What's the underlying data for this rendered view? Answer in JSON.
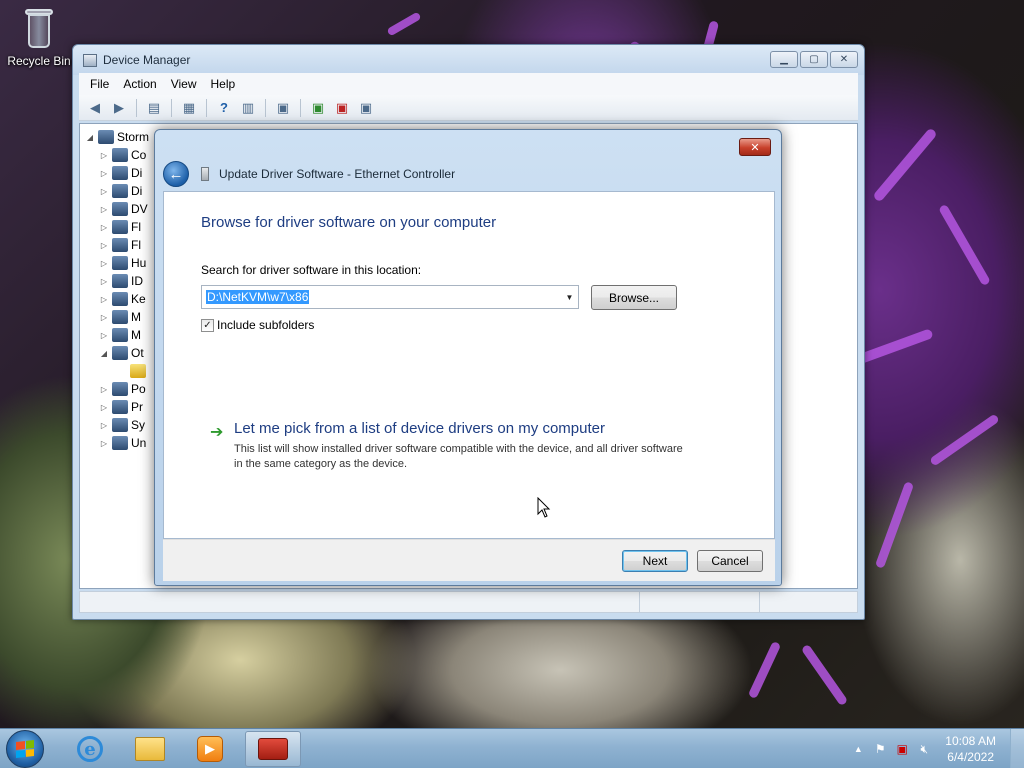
{
  "desktop": {
    "recycle_bin_label": "Recycle Bin"
  },
  "device_manager": {
    "title": "Device Manager",
    "menu": [
      "File",
      "Action",
      "View",
      "Help"
    ],
    "tree_root": "Storm",
    "tree_items": [
      "Co",
      "Di",
      "Di",
      "DV",
      "Fl",
      "Fl",
      "Hu",
      "ID",
      "Ke",
      "M",
      "M",
      "Ot",
      "",
      "Po",
      "Pr",
      "Sy",
      "Un"
    ]
  },
  "dialog": {
    "window_title": "Update Driver Software - Ethernet Controller",
    "close_glyph": "✕",
    "heading": "Browse for driver software on your computer",
    "search_label": "Search for driver software in this location:",
    "path_value": "D:\\NetKVM\\w7\\x86",
    "browse_label": "Browse...",
    "include_subfolders_label": "Include subfolders",
    "include_subfolders_checked": true,
    "pick_title": "Let me pick from a list of device drivers on my computer",
    "pick_description": "This list will show installed driver software compatible with the device, and all driver software in the same category as the device.",
    "next_label": "Next",
    "cancel_label": "Cancel"
  },
  "taskbar": {
    "pinned": [
      "internet-explorer-icon",
      "windows-explorer-icon",
      "media-player-icon",
      "device-manager-icon"
    ],
    "time": "10:08 AM",
    "date": "6/4/2022"
  },
  "colors": {
    "dialog_heading": "#1e3d82",
    "selection": "#3399ff",
    "link_arrow": "#2e9a2e",
    "close_button": "#c8402b"
  }
}
